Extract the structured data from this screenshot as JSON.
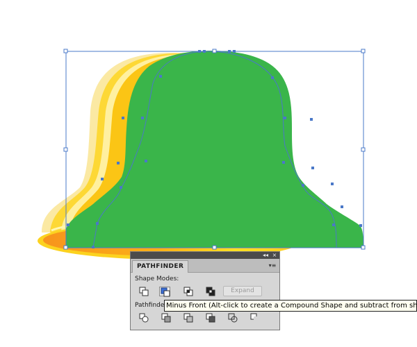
{
  "panel": {
    "tab_title": "PATHFINDER",
    "shape_modes_label": "Shape Modes:",
    "pathfinders_label": "Pathfinde",
    "expand_label": "Expand",
    "collapse_glyph": "◂◂",
    "close_glyph": "×",
    "menu_glyph": "▾≡",
    "shape_mode_buttons": [
      "unite-icon",
      "minus-front-icon",
      "intersect-icon",
      "exclude-icon"
    ],
    "pathfinder_buttons": [
      "divide-icon",
      "trim-icon",
      "merge-icon",
      "crop-icon",
      "outline-icon",
      "minus-back-icon"
    ]
  },
  "tooltip": {
    "text": "Minus Front (Alt-click to create a Compound Shape and subtract from shape"
  },
  "colors": {
    "bell_green": "#3ab54a",
    "selection_blue": "#4a78c8",
    "rim_orange": "#f39a16",
    "bell_yellow": "#fcd21f"
  }
}
